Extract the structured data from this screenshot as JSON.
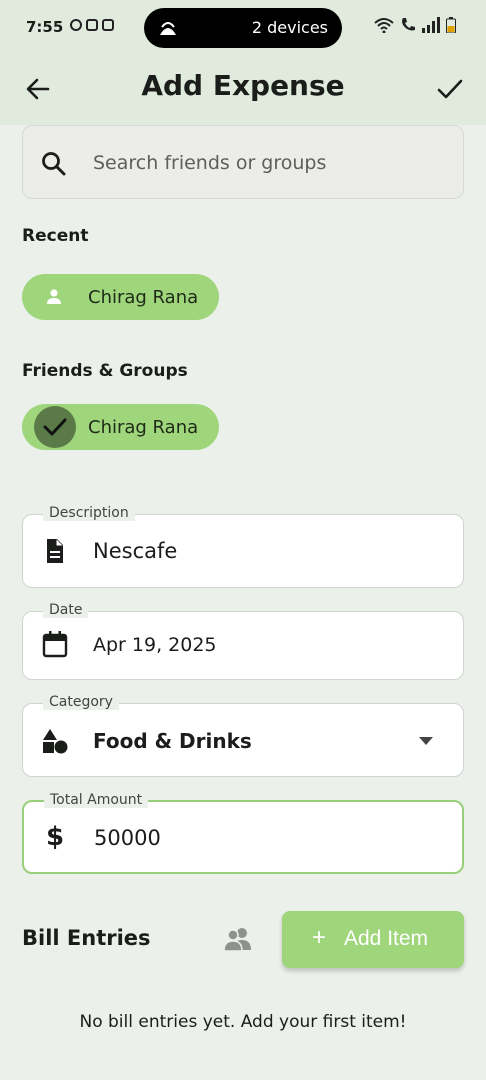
{
  "status_bar": {
    "time": "7:55",
    "pill_text": "2 devices"
  },
  "app_bar": {
    "title": "Add Expense"
  },
  "search": {
    "placeholder": "Search friends or groups"
  },
  "recent": {
    "label": "Recent",
    "chip": "Chirag Rana"
  },
  "friends_groups": {
    "label": "Friends & Groups",
    "chip": "Chirag Rana",
    "selected": true
  },
  "form": {
    "description": {
      "label": "Description",
      "value": "Nescafe",
      "icon": "document-icon"
    },
    "date": {
      "label": "Date",
      "value": "Apr 19, 2025",
      "icon": "calendar-icon"
    },
    "category": {
      "label": "Category",
      "value": "Food & Drinks",
      "icon": "shapes-icon"
    },
    "total_amount": {
      "label": "Total Amount",
      "value": "50000",
      "icon": "dollar-icon"
    }
  },
  "bill_entries": {
    "title": "Bill Entries",
    "add_button": "Add Item",
    "add_button_icon": "+",
    "empty_text": "No bill entries yet. Add your first item!"
  },
  "colors": {
    "accent": "#9fd57b",
    "app_bar": "#e0ebdd",
    "background": "#ecf0eb"
  }
}
